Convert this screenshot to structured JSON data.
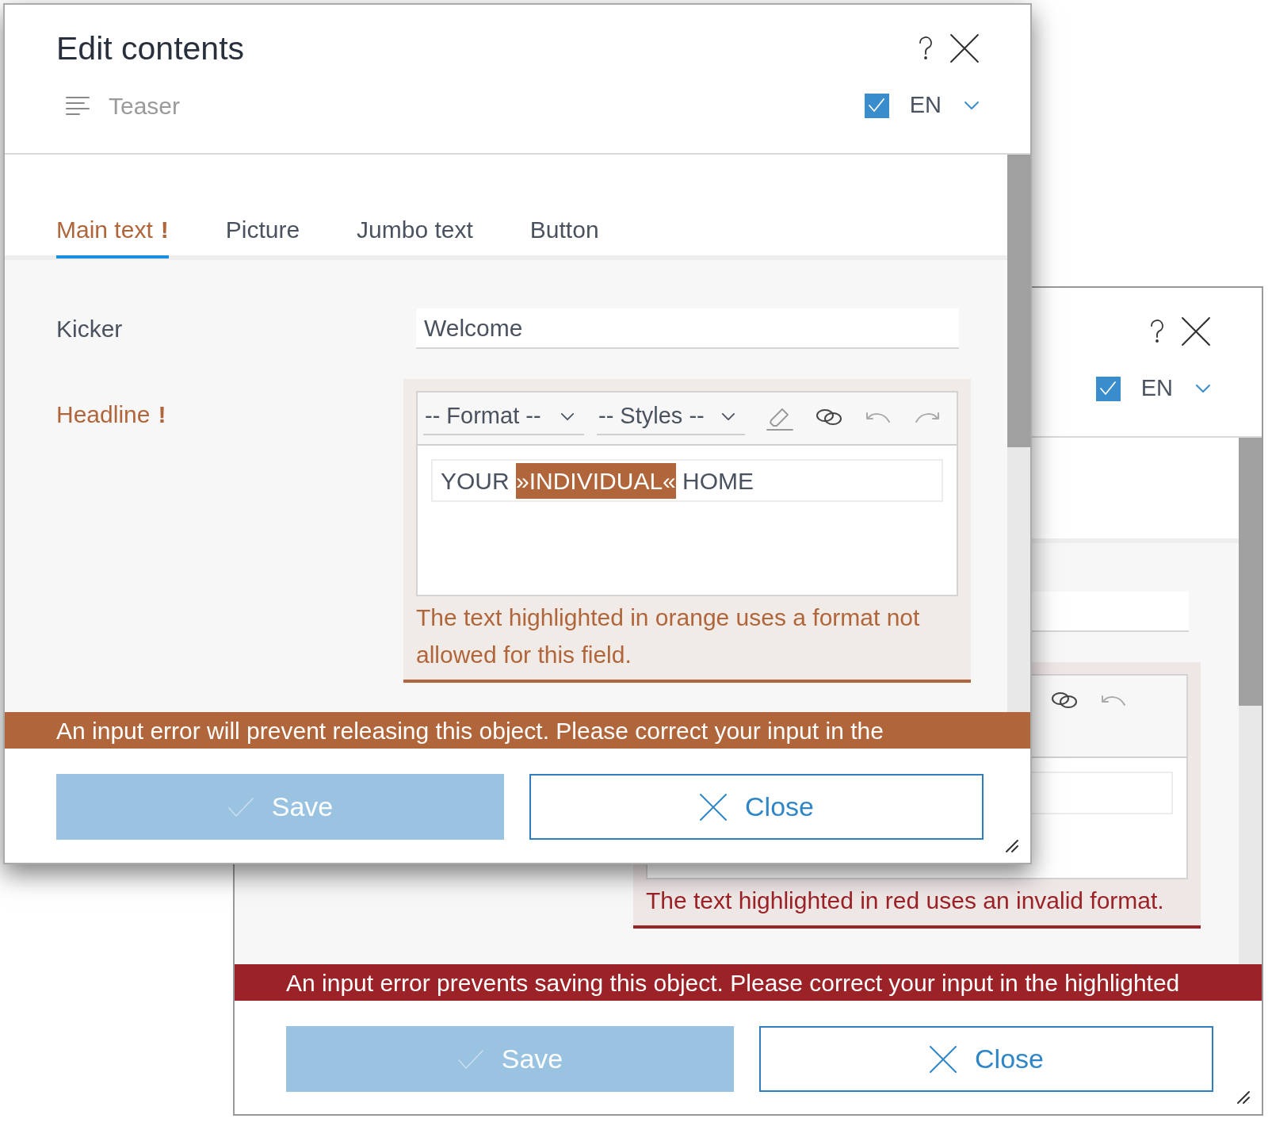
{
  "front_dialog": {
    "title": "Edit contents",
    "subtitle": "Teaser",
    "language": {
      "checked": true,
      "code": "EN"
    },
    "tabs": [
      {
        "label": "Main text",
        "error_mark": "!",
        "selected": true
      },
      {
        "label": "Picture",
        "selected": false
      },
      {
        "label": "Jumbo text",
        "selected": false
      },
      {
        "label": "Button",
        "selected": false
      }
    ],
    "fields": [
      {
        "kind": "text",
        "label": "Kicker",
        "value": "Welcome"
      },
      {
        "kind": "editor",
        "label": "Headline",
        "error_mark": "!",
        "format_select": "-- Format --",
        "styles_select": "-- Styles --",
        "content": [
          {
            "text": "YOUR ",
            "highlighted": false
          },
          {
            "text": "»INDIVIDUAL«",
            "highlighted": true
          },
          {
            "text": " HOME",
            "highlighted": false
          }
        ],
        "message": "The text highlighted in orange uses a format not allowed for this field."
      }
    ],
    "banner": {
      "text": "An input error will prevent releasing this object. Please correct your input in the",
      "color": "#b0653a"
    },
    "buttons": [
      {
        "kind": "save",
        "label": "Save",
        "disabled": true
      },
      {
        "kind": "close",
        "label": "Close"
      }
    ]
  },
  "back_dialog": {
    "language": {
      "checked": true,
      "code": "EN"
    },
    "fields": [
      {
        "kind": "text"
      },
      {
        "kind": "editor",
        "message": "The text highlighted in red uses an invalid format."
      }
    ],
    "banner": {
      "text": "An input error prevents saving this object. Please correct your input in the highlighted",
      "color": "#9b2226"
    },
    "buttons": [
      {
        "kind": "save",
        "label": "Save",
        "disabled": true
      },
      {
        "kind": "close",
        "label": "Close"
      }
    ]
  }
}
